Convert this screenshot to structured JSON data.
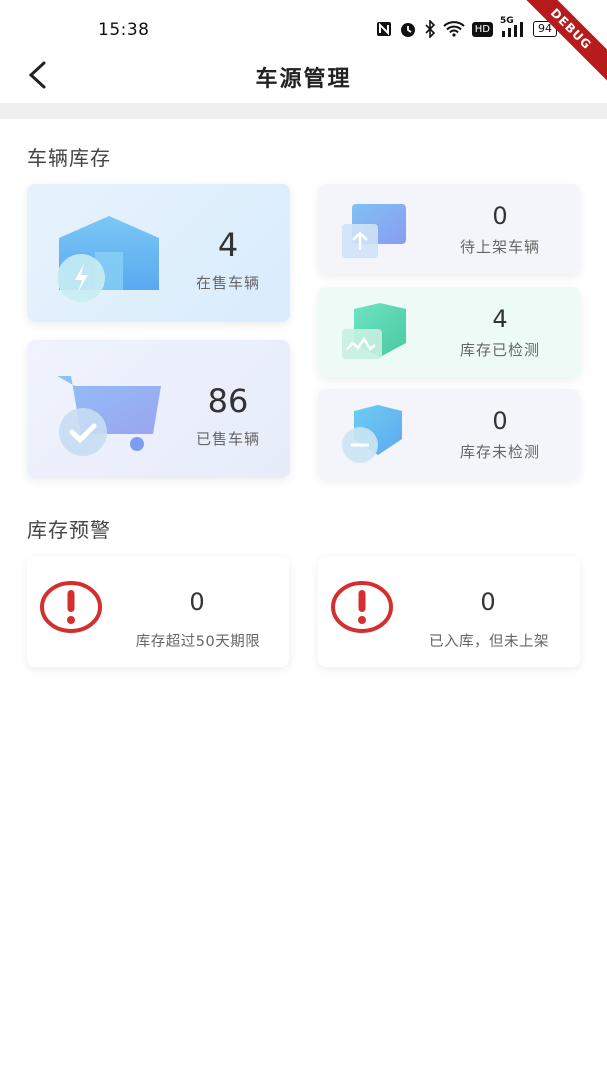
{
  "status_bar": {
    "time": "15:38",
    "icons": [
      "nfc-icon",
      "alarm-icon",
      "bluetooth-icon",
      "wifi-icon",
      "hd-icon",
      "signal-5g-icon"
    ],
    "hd_label": "HD",
    "signal_label": "5G",
    "battery": "94",
    "debug_banner": "DEBUG"
  },
  "nav": {
    "title": "车源管理"
  },
  "inventory": {
    "section_title": "车辆库存",
    "on_sale": {
      "value": "4",
      "label": "在售车辆"
    },
    "sold": {
      "value": "86",
      "label": "已售车辆"
    },
    "pending_listing": {
      "value": "0",
      "label": "待上架车辆"
    },
    "inspected": {
      "value": "4",
      "label": "库存已检测"
    },
    "not_inspected": {
      "value": "0",
      "label": "库存未检测"
    }
  },
  "warnings": {
    "section_title": "库存预警",
    "over_50_days": {
      "value": "0",
      "label": "库存超过50天期限"
    },
    "not_listed": {
      "value": "0",
      "label": "已入库，但未上架"
    }
  },
  "colors": {
    "warning_red": "#d32f2f",
    "card_blue_bg": "#e3f1fd",
    "card_gray_bg": "#f3f5fb",
    "card_green_bg": "#eefaf6",
    "debug_red": "#b71c1c"
  }
}
